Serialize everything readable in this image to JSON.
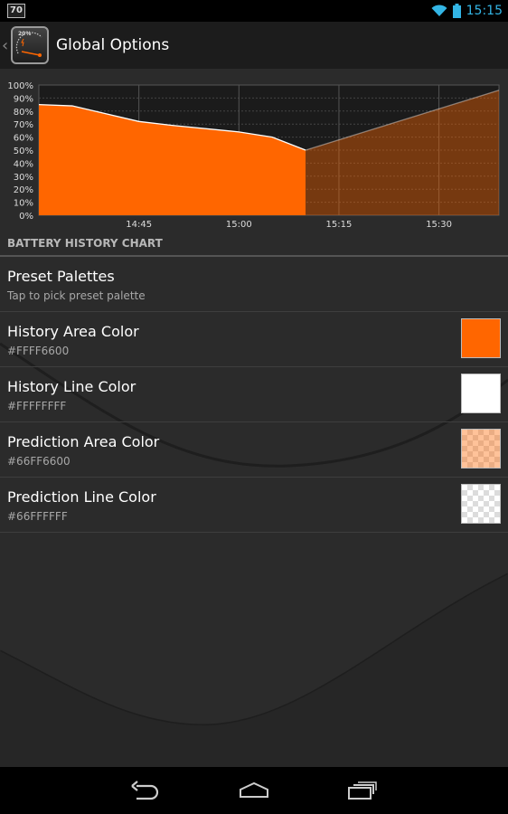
{
  "status_bar": {
    "badge": "70",
    "time": "15:15",
    "accent": "#33b5e5"
  },
  "action_bar": {
    "title": "Global Options",
    "icon_label": "20%"
  },
  "chart_data": {
    "type": "area",
    "yticks": [
      "100%",
      "90%",
      "80%",
      "70%",
      "60%",
      "50%",
      "40%",
      "30%",
      "20%",
      "10%",
      "0%"
    ],
    "xticks": [
      "14:45",
      "15:00",
      "15:15",
      "15:30"
    ],
    "ylim": [
      0,
      100
    ],
    "xlim": [
      "14:30",
      "15:39"
    ],
    "grid": true,
    "series": [
      {
        "role": "history",
        "x": [
          "14:30",
          "14:35",
          "14:45",
          "14:50",
          "15:00",
          "15:05",
          "15:10"
        ],
        "values": [
          85,
          84,
          72,
          69,
          64,
          60,
          50
        ],
        "area_color": "#FFFF6600",
        "line_color": "#FFFFFFFF"
      },
      {
        "role": "prediction",
        "x": [
          "15:10",
          "15:39"
        ],
        "values": [
          50,
          96
        ],
        "area_color": "#66FF6600",
        "line_color": "#66FFFFFF"
      }
    ]
  },
  "section": {
    "title": "BATTERY HISTORY CHART"
  },
  "preferences": [
    {
      "title": "Preset Palettes",
      "summary": "Tap to pick preset palette"
    },
    {
      "title": "History Area Color",
      "summary": "#FFFF6600",
      "swatch": "#FF6600"
    },
    {
      "title": "History Line Color",
      "summary": "#FFFFFFFF",
      "swatch": "#FFFFFF"
    },
    {
      "title": "Prediction Area Color",
      "summary": "#66FF6600",
      "swatch": "#FF6600",
      "swatch_alpha": 0.4
    },
    {
      "title": "Prediction Line Color",
      "summary": "#66FFFFFF",
      "swatch": "#FFFFFF",
      "swatch_alpha": 0.4
    }
  ],
  "nav": {
    "back_icon": "back-icon",
    "home_icon": "home-icon",
    "recents_icon": "recent-apps-icon"
  }
}
